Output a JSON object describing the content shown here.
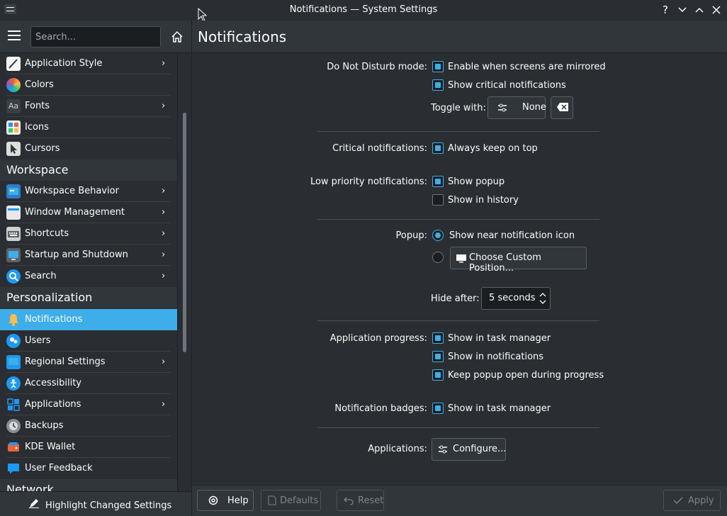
{
  "window": {
    "title": "Notifications — System Settings"
  },
  "sidebar": {
    "search_placeholder": "Search...",
    "items": [
      {
        "label": "Application Style",
        "icon": "brush-icon",
        "color": "#f4f4f4",
        "chevron": true
      },
      {
        "label": "Colors",
        "icon": "color-wheel-icon",
        "color": "#e9643a",
        "chevron": false
      },
      {
        "label": "Fonts",
        "icon": "font-icon",
        "color": "#5c6166",
        "chevron": true
      },
      {
        "label": "Icons",
        "icon": "icons-grid-icon",
        "color": "#f0f0f0",
        "chevron": false
      },
      {
        "label": "Cursors",
        "icon": "cursor-icon",
        "color": "#dcdcdc",
        "chevron": false
      }
    ],
    "section_workspace": "Workspace",
    "workspace_items": [
      {
        "label": "Workspace Behavior",
        "icon": "workspace-icon",
        "color": "#2c7ec9",
        "chevron": true
      },
      {
        "label": "Window Management",
        "icon": "window-icon",
        "color": "#e8e8e8",
        "chevron": true
      },
      {
        "label": "Shortcuts",
        "icon": "keyboard-icon",
        "color": "#cfcfcf",
        "chevron": true
      },
      {
        "label": "Startup and Shutdown",
        "icon": "startup-icon",
        "color": "#3daee9",
        "chevron": true
      },
      {
        "label": "Search",
        "icon": "search-icon",
        "color": "#1d99f3",
        "chevron": true
      }
    ],
    "section_personalization": "Personalization",
    "personal_items": [
      {
        "label": "Notifications",
        "icon": "bell-icon",
        "color": "#fdbc4b",
        "chevron": false,
        "selected": true
      },
      {
        "label": "Users",
        "icon": "users-icon",
        "color": "#1d99f3",
        "chevron": false
      },
      {
        "label": "Regional Settings",
        "icon": "regional-icon",
        "color": "#1d99f3",
        "chevron": true
      },
      {
        "label": "Accessibility",
        "icon": "accessibility-icon",
        "color": "#1d99f3",
        "chevron": false
      },
      {
        "label": "Applications",
        "icon": "applications-icon",
        "color": "#1d99f3",
        "chevron": true
      },
      {
        "label": "Backups",
        "icon": "backups-icon",
        "color": "#8a8e92",
        "chevron": false
      },
      {
        "label": "KDE Wallet",
        "icon": "wallet-icon",
        "color": "#e9643a",
        "chevron": false
      },
      {
        "label": "User Feedback",
        "icon": "feedback-icon",
        "color": "#1d99f3",
        "chevron": false
      }
    ],
    "section_network": "Network",
    "highlight_button": "Highlight Changed Settings"
  },
  "main": {
    "page_title": "Notifications",
    "dnd": {
      "label": "Do Not Disturb mode:",
      "opt_mirrored": "Enable when screens are mirrored",
      "opt_critical": "Show critical notifications",
      "toggle_label": "Toggle with:",
      "toggle_value": "None"
    },
    "critical": {
      "label": "Critical notifications:",
      "opt": "Always keep on top"
    },
    "low": {
      "label": "Low priority notifications:",
      "opt_popup": "Show popup",
      "opt_history": "Show in history"
    },
    "popup": {
      "label": "Popup:",
      "opt_near": "Show near notification icon",
      "custom_button": "Choose Custom Position...",
      "hide_label": "Hide after:",
      "hide_value": "5 seconds"
    },
    "progress": {
      "label": "Application progress:",
      "opt_task": "Show in task manager",
      "opt_notif": "Show in notifications",
      "opt_keep": "Keep popup open during progress"
    },
    "badges": {
      "label": "Notification badges:",
      "opt": "Show in task manager"
    },
    "apps": {
      "label": "Applications:",
      "button": "Configure..."
    }
  },
  "footer": {
    "help": "Help",
    "defaults": "Defaults",
    "reset": "Reset",
    "apply": "Apply"
  },
  "colors": {
    "accent": "#3daee9",
    "background": "#2a2e32",
    "text": "#fcfcfc"
  }
}
